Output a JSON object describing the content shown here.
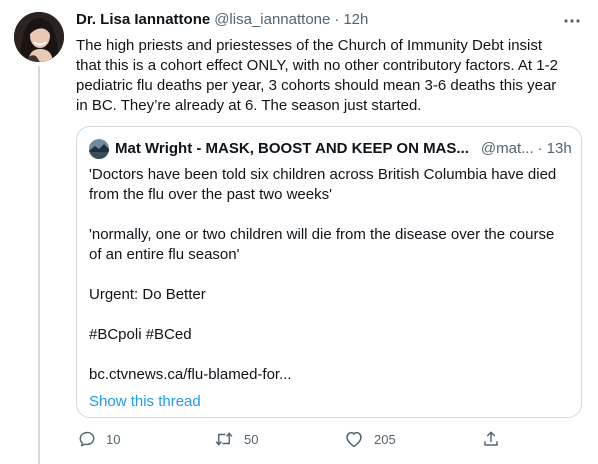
{
  "tweet": {
    "display_name": "Dr. Lisa Iannattone",
    "handle": "@lisa_iannattone",
    "separator": "·",
    "time": "12h",
    "text": "The high priests and priestesses of the Church of Immunity Debt insist that this is a cohort effect ONLY, with no other contributory factors. At 1-2 pediatric flu deaths per year, 3 cohorts should mean 3-6 deaths this year in BC. They’re already at 6. The season just started."
  },
  "quote": {
    "display_name": "Mat Wright - MASK, BOOST AND KEEP ON MAS...",
    "handle": "@mat...",
    "separator": "·",
    "time": "13h",
    "paragraphs": [
      "'Doctors have been told six children across British Columbia have died from the flu over the past two weeks'",
      "'normally, one or two children will die from the disease over the course of an entire flu season'",
      "Urgent: Do Better",
      "#BCpoli #BCed",
      "bc.ctvnews.ca/flu-blamed-for..."
    ],
    "show_thread": "Show this thread"
  },
  "actions": {
    "reply_count": "10",
    "retweet_count": "50",
    "like_count": "205"
  },
  "icons": {
    "more": "more-horizontal-icon",
    "reply": "reply-icon",
    "retweet": "retweet-icon",
    "like": "heart-icon",
    "share": "share-icon"
  },
  "colors": {
    "text": "#0f1419",
    "secondary": "#536471",
    "link": "#1d9bf0",
    "border": "#cfd9de"
  }
}
